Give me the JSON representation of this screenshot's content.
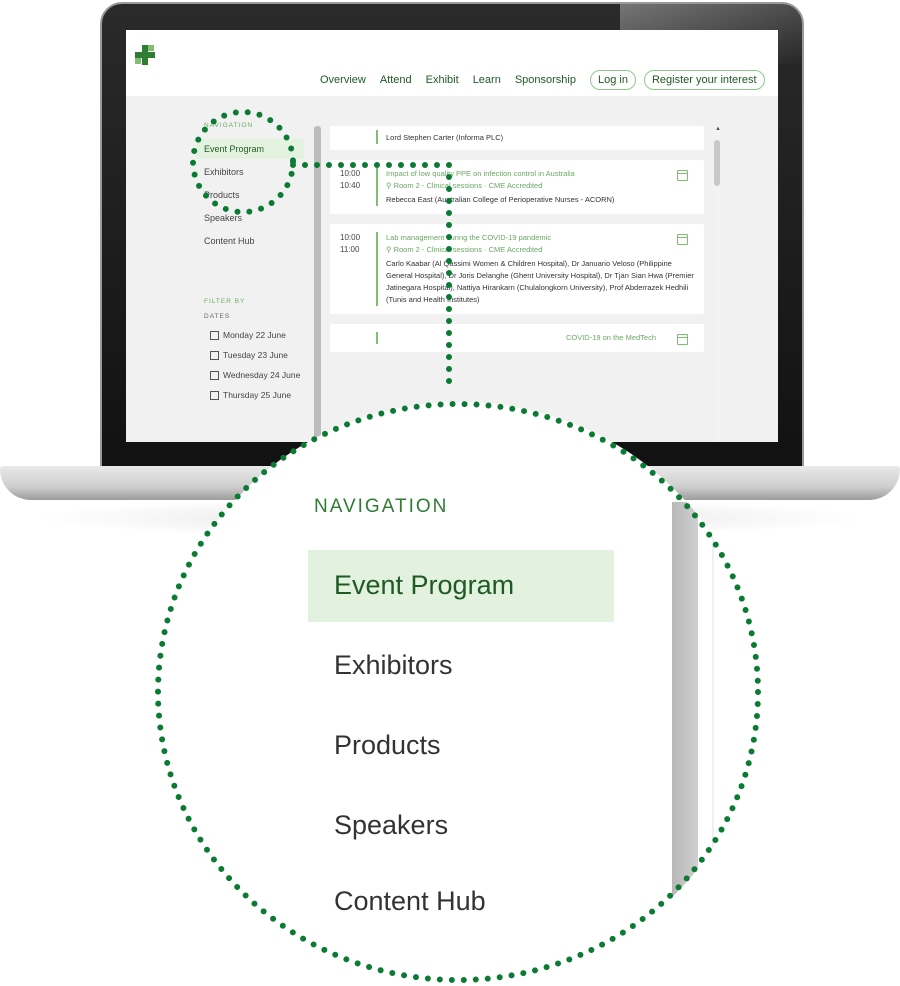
{
  "site": {
    "nav": {
      "links": [
        "Overview",
        "Attend",
        "Exhibit",
        "Learn",
        "Sponsorship"
      ],
      "login_label": "Log in",
      "register_label": "Register your interest"
    },
    "sidebar": {
      "heading": "NAVIGATION",
      "items": [
        "Event Program",
        "Exhibitors",
        "Products",
        "Speakers",
        "Content Hub"
      ],
      "active_item": "Event Program"
    },
    "filter": {
      "heading": "FILTER BY",
      "dates_label": "DATES",
      "options": [
        "Monday 22 June",
        "Tuesday 23 June",
        "Wednesday 24 June",
        "Thursday 25 June"
      ]
    },
    "sessions": [
      {
        "time_start": "",
        "time_end": "",
        "title": "",
        "location": "",
        "speakers": "Lord Stephen Carter (Informa PLC)"
      },
      {
        "time_start": "10:00",
        "time_end": "10:40",
        "title": "Impact of low quality PPE on infection control in Australia",
        "location": "Room 2 - Clinical sessions · CME Accredited",
        "speakers": "Rebecca East (Australian College of Perioperative Nurses - ACORN)"
      },
      {
        "time_start": "10:00",
        "time_end": "11:00",
        "title": "Lab management during the COVID-19 pandemic",
        "location": "Room 2 - Clinical sessions · CME Accredited",
        "speakers": "Carlo Kaabar (Al Qassimi Women & Children Hospital), Dr Januario Veloso (Philippine General Hospital), Dr Joris Delanghe (Ghent University Hospital), Dr Tjan Sian Hwa (Premier Jatinegara Hospital), Nattiya Hirankarn (Chulalongkorn University), Prof Abderrazek Hedhili (Tunis and Health Institutes)"
      },
      {
        "time_start": "",
        "time_end": "",
        "title": "COVID-19 on the MedTech",
        "location": "",
        "speakers": ""
      }
    ]
  },
  "zoom": {
    "heading": "NAVIGATION",
    "items": [
      "Event Program",
      "Exhibitors",
      "Products",
      "Speakers",
      "Content Hub"
    ]
  },
  "colors": {
    "brand_green": "#2e7d32",
    "accent_green": "#6aa964",
    "active_bg": "#e3f1df",
    "callout_dots": "#0b7a33"
  },
  "icons": [
    "plus-logo-icon",
    "location-pin-icon",
    "calendar-icon",
    "checkbox-icon"
  ]
}
